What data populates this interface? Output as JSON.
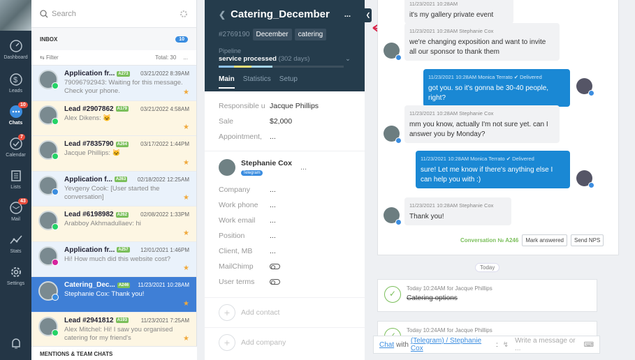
{
  "nav": {
    "items": [
      {
        "label": "Dashboard",
        "icon": "dashboard-icon"
      },
      {
        "label": "Leads",
        "icon": "leads-icon"
      },
      {
        "label": "Chats",
        "icon": "chats-icon",
        "badge": "10",
        "active": true
      },
      {
        "label": "Calendar",
        "icon": "calendar-icon",
        "badge": "7"
      },
      {
        "label": "Lists",
        "icon": "lists-icon"
      },
      {
        "label": "Mail",
        "icon": "mail-icon",
        "badge": "43"
      },
      {
        "label": "Stats",
        "icon": "stats-icon"
      },
      {
        "label": "Settings",
        "icon": "settings-icon"
      }
    ]
  },
  "list": {
    "search_placeholder": "Search",
    "inbox_label": "INBOX",
    "inbox_count": "10",
    "filter_label": "Filter",
    "total": "Total: 30",
    "more": "...",
    "mentions": "MENTIONS & TEAM CHATS",
    "leads": [
      {
        "title": "Application fr...",
        "tag": "A273",
        "date": "03/21/2022 8:39AM",
        "msg": "79096792943: Waiting for this message. Check your phone.",
        "channel": "whatsapp",
        "bg": "blue"
      },
      {
        "title": "Lead #2907862",
        "tag": "A179",
        "date": "03/21/2022 4:58AM",
        "msg": "Alex Dikens: 😺",
        "channel": "whatsapp",
        "bg": "yellow"
      },
      {
        "title": "Lead #7835790",
        "tag": "A264",
        "date": "03/17/2022 1:44PM",
        "msg": "Jacque Phillips: 🐱",
        "channel": "whatsapp",
        "bg": "yellow"
      },
      {
        "title": "Application f...",
        "tag": "A263",
        "date": "02/18/2022 12:25AM",
        "msg": "Yevgeny Cook: [User started the conversation]",
        "channel": "telegram",
        "bg": "blue"
      },
      {
        "title": "Lead #6198982",
        "tag": "A262",
        "date": "02/08/2022 1:33PM",
        "msg": "Arabboy Akhmadullaev: hi",
        "channel": "whatsapp",
        "bg": "yellow"
      },
      {
        "title": "Application fr...",
        "tag": "A257",
        "date": "12/01/2021 1:46PM",
        "msg": "Hi! How much did this website cost?",
        "channel": "instagram",
        "bg": "blue"
      },
      {
        "title": "Catering_Dec...",
        "tag": "A246",
        "date": "11/23/2021 10:28AM",
        "msg": "Stephanie Cox: Thank you!",
        "channel": "telegram",
        "bg": "sel"
      },
      {
        "title": "Lead #2941812",
        "tag": "A193",
        "date": "11/23/2021 7:25AM",
        "msg": "Alex Mitchel: Hi! I saw you organised catering for my friend's",
        "channel": "whatsapp",
        "bg": "yellow"
      }
    ]
  },
  "card": {
    "title": "Catering_December",
    "more": "...",
    "id": "#2769190",
    "tags": [
      "December",
      "catering"
    ],
    "pipeline_label": "Pipeline",
    "stage": "service processed",
    "days": "(302 days)",
    "tabs": [
      "Main",
      "Statistics",
      "Setup"
    ],
    "fields": [
      {
        "k": "Responsible u",
        "v": "Jacque Phillips"
      },
      {
        "k": "Sale",
        "v": "$2,000"
      },
      {
        "k": "Appointment,",
        "v": "..."
      }
    ],
    "contact_name": "Stephanie  Cox",
    "contact_tag": "Telegram",
    "contact_more": "...",
    "cfields": [
      {
        "k": "Company",
        "v": "..."
      },
      {
        "k": "Work phone",
        "v": "..."
      },
      {
        "k": "Work email",
        "v": "..."
      },
      {
        "k": "Position",
        "v": "..."
      },
      {
        "k": "Client, MB",
        "v": "..."
      },
      {
        "k": "MailChimp",
        "v": ""
      },
      {
        "k": "User terms",
        "v": ""
      }
    ],
    "add_contact": "Add contact",
    "add_company": "Add company"
  },
  "feed": {
    "messages": [
      {
        "stamp": "11/23/2021 10:28AM",
        "text": "it's my gallery private event"
      },
      {
        "stamp": "11/23/2021 10:28AM Stephanie Cox",
        "text": "we're changing exposition and want to invite all our sponsor to thank them"
      },
      {
        "stamp": "11/23/2021 10:28AM Monica Terrato  ✔ Delivered",
        "text": "got you. so it's gonna be 30-40 people, right?"
      },
      {
        "stamp": "11/23/2021 10:28AM Stephanie Cox",
        "text": "mm you know, actually I'm not sure yet. can I answer you by Monday?"
      },
      {
        "stamp": "11/23/2021 10:28AM Monica Terrato  ✔ Delivered",
        "text": "sure! Let me know if there's anything else I can help you with :)"
      },
      {
        "stamp": "11/23/2021 10:28AM Stephanie Cox",
        "text": "Thank you!"
      }
    ],
    "conversation": "Conversation № A246",
    "mark_answered": "Mark answered",
    "send_nps": "Send NPS",
    "today": "Today",
    "tasks": [
      {
        "meta": "Today 10:24AM  for Jacque Phillips",
        "text": "Catering options"
      },
      {
        "meta": "Today 10:24AM  for Jacque Phillips",
        "text": ""
      }
    ],
    "composer": {
      "chat": "Chat",
      "with": "with",
      "channel": "(Telegram) / Stephanie Cox",
      "colon": ":",
      "placeholder": "Write a message or ..."
    }
  }
}
